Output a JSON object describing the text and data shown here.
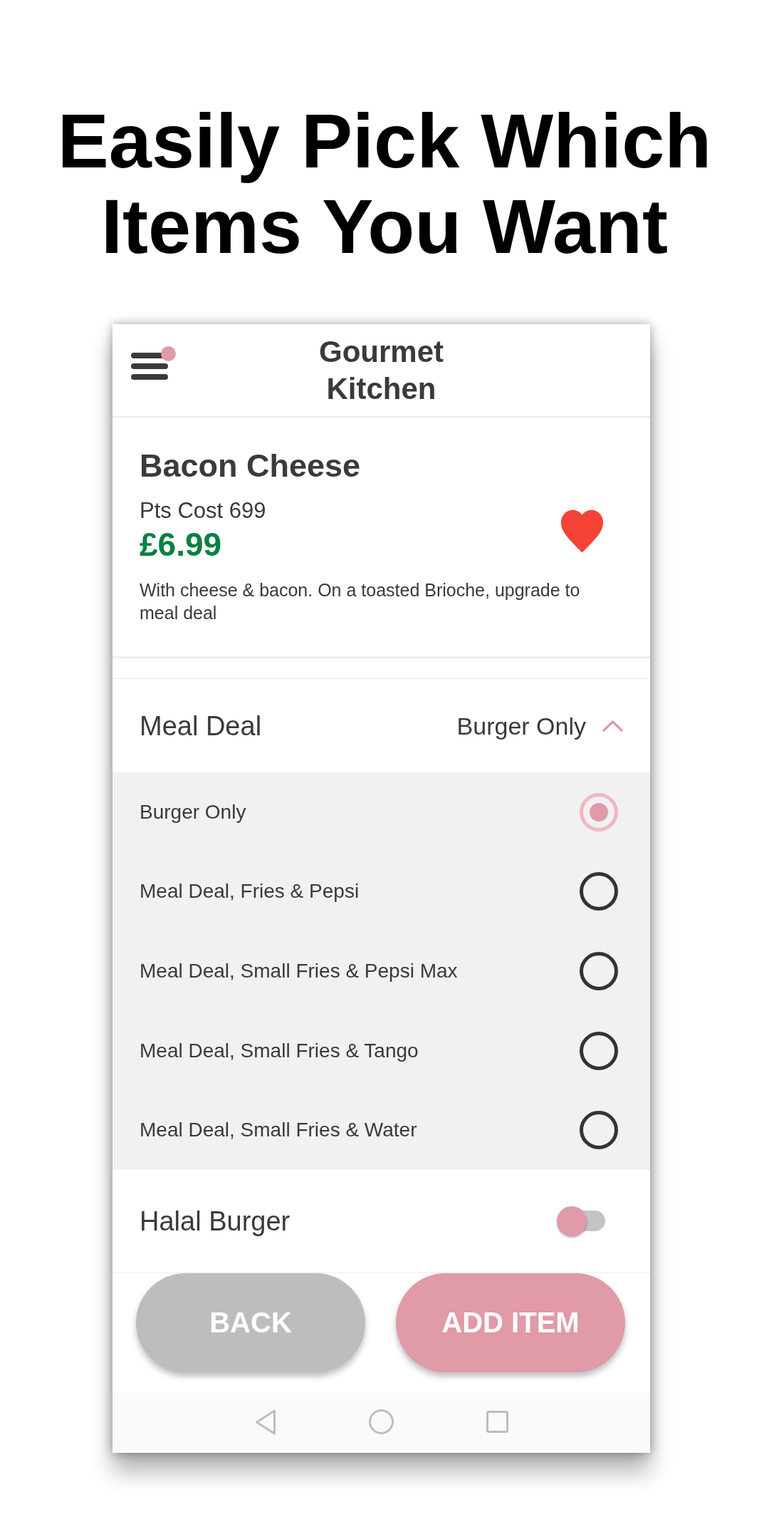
{
  "headline": "Easily Pick Which Items You Want",
  "app_bar": {
    "title": "Gourmet Kitchen",
    "has_notification": true
  },
  "item": {
    "name": "Bacon Cheese",
    "points_cost": "Pts Cost 699",
    "price": "£6.99",
    "favorite": true,
    "description": "With cheese & bacon. On a toasted Brioche, upgrade to meal deal"
  },
  "option_group": {
    "title": "Meal Deal",
    "selected_value": "Burger Only",
    "expanded": true,
    "options": [
      {
        "label": "Burger Only",
        "selected": true
      },
      {
        "label": "Meal Deal, Fries & Pepsi",
        "selected": false
      },
      {
        "label": "Meal Deal, Small Fries & Pepsi Max",
        "selected": false
      },
      {
        "label": "Meal Deal, Small Fries & Tango",
        "selected": false
      },
      {
        "label": "Meal Deal, Small Fries & Water",
        "selected": false
      }
    ]
  },
  "toggle": {
    "label": "Halal Burger",
    "on": false
  },
  "buttons": [
    {
      "label": "BACK",
      "kind": "secondary"
    },
    {
      "label": "ADD ITEM",
      "kind": "primary"
    }
  ]
}
